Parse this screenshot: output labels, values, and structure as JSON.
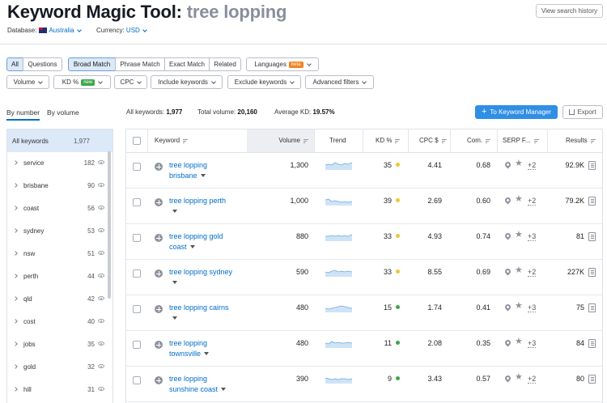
{
  "header": {
    "title_prefix": "Keyword Magic Tool:",
    "title_keyword": "tree lopping",
    "view_history_label": "View search history",
    "database_label": "Database:",
    "database_value": "Australia",
    "currency_label": "Currency:",
    "currency_value": "USD"
  },
  "filters": {
    "all_label": "All",
    "questions_label": "Questions",
    "broad_label": "Broad Match",
    "phrase_label": "Phrase Match",
    "exact_label": "Exact Match",
    "related_label": "Related",
    "languages_label": "Languages",
    "languages_badge": "beta",
    "volume_label": "Volume",
    "kd_label": "KD %",
    "kd_badge": "new",
    "cpc_label": "CPC",
    "include_label": "Include keywords",
    "exclude_label": "Exclude keywords",
    "advanced_label": "Advanced filters"
  },
  "subtabs": {
    "by_number": "By number",
    "by_volume": "By volume"
  },
  "stats": {
    "all_keywords_label": "All keywords:",
    "all_keywords_value": "1,977",
    "total_volume_label": "Total volume:",
    "total_volume_value": "20,160",
    "average_kd_label": "Average KD:",
    "average_kd_value": "19.57%"
  },
  "actions": {
    "manager_label": "To Keyword Manager",
    "export_label": "Export"
  },
  "sidebar": {
    "items": [
      {
        "label": "All keywords",
        "count": "1,977"
      },
      {
        "label": "service",
        "count": "182"
      },
      {
        "label": "brisbane",
        "count": "90"
      },
      {
        "label": "coast",
        "count": "56"
      },
      {
        "label": "sydney",
        "count": "53"
      },
      {
        "label": "nsw",
        "count": "51"
      },
      {
        "label": "perth",
        "count": "44"
      },
      {
        "label": "qld",
        "count": "42"
      },
      {
        "label": "cost",
        "count": "40"
      },
      {
        "label": "jobs",
        "count": "35"
      },
      {
        "label": "gold",
        "count": "32"
      },
      {
        "label": "hill",
        "count": "31"
      }
    ]
  },
  "table": {
    "headers": {
      "keyword": "Keyword",
      "volume": "Volume",
      "trend": "Trend",
      "kd": "KD %",
      "cpc": "CPC $",
      "com": "Com.",
      "serp": "SERP F...",
      "results": "Results"
    },
    "rows": [
      {
        "keyword_line1": "tree lopping",
        "keyword_line2": "brisbane",
        "volume": "1,300",
        "kd": "35",
        "kd_color": "#f0c53a",
        "cpc": "4.41",
        "com": "0.68",
        "serp_more": "+2",
        "results": "92.9K"
      },
      {
        "keyword_line1": "tree lopping perth",
        "keyword_line2": "",
        "volume": "1,000",
        "kd": "39",
        "kd_color": "#f0c53a",
        "cpc": "2.69",
        "com": "0.60",
        "serp_more": "+2",
        "results": "79.2K"
      },
      {
        "keyword_line1": "tree lopping gold",
        "keyword_line2": "coast",
        "volume": "880",
        "kd": "33",
        "kd_color": "#f0c53a",
        "cpc": "4.93",
        "com": "0.74",
        "serp_more": "+3",
        "results": "81"
      },
      {
        "keyword_line1": "tree lopping sydney",
        "keyword_line2": "",
        "volume": "590",
        "kd": "33",
        "kd_color": "#f0c53a",
        "cpc": "8.55",
        "com": "0.69",
        "serp_more": "+2",
        "results": "227K"
      },
      {
        "keyword_line1": "tree lopping cairns",
        "keyword_line2": "",
        "volume": "480",
        "kd": "15",
        "kd_color": "#3aa84a",
        "cpc": "1.74",
        "com": "0.41",
        "serp_more": "+3",
        "results": "75"
      },
      {
        "keyword_line1": "tree lopping",
        "keyword_line2": "townsville",
        "volume": "480",
        "kd": "11",
        "kd_color": "#3aa84a",
        "cpc": "2.08",
        "com": "0.35",
        "serp_more": "+3",
        "results": "84"
      },
      {
        "keyword_line1": "tree lopping",
        "keyword_line2": "sunshine coast",
        "volume": "390",
        "kd": "9",
        "kd_color": "#3aa84a",
        "cpc": "3.43",
        "com": "0.57",
        "serp_more": "+2",
        "results": "80"
      }
    ]
  }
}
